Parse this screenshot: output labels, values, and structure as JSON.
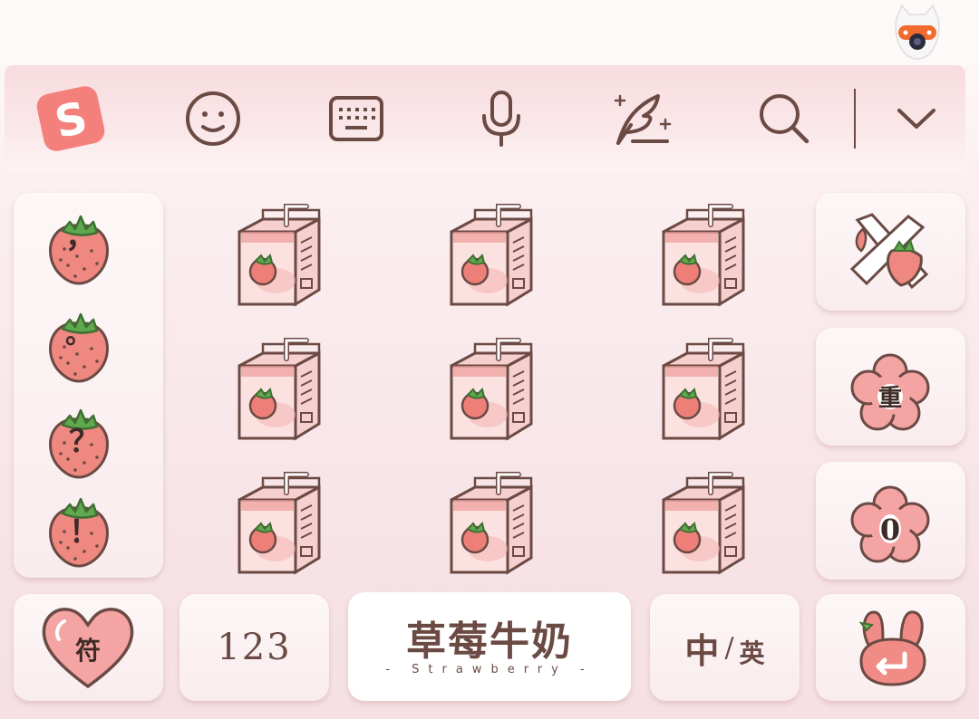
{
  "toolbar": {
    "logo_letter": "S",
    "icons": [
      "emoji-icon",
      "keyboard-icon",
      "microphone-icon",
      "handwriting-quill-icon",
      "search-icon",
      "chevron-down-icon"
    ]
  },
  "punctuation": [
    {
      "char": "，",
      "name": "comma"
    },
    {
      "char": "。",
      "name": "period"
    },
    {
      "char": "？",
      "name": "question"
    },
    {
      "char": "！",
      "name": "exclamation"
    }
  ],
  "candidates": [
    "strawberry-milk-box-sticker",
    "strawberry-milk-box-sticker",
    "strawberry-milk-box-sticker",
    "strawberry-milk-box-sticker",
    "strawberry-milk-box-sticker",
    "strawberry-milk-box-sticker",
    "strawberry-milk-box-sticker",
    "strawberry-milk-box-sticker",
    "strawberry-milk-box-sticker"
  ],
  "right_keys": {
    "delete_icon": "strawberry-x-delete-icon",
    "reenter_label": "重",
    "zero_label": "0"
  },
  "bottom_row": {
    "symbol_label": "符",
    "number_label": "123",
    "space_title": "草莓牛奶",
    "space_subtitle": "- Strawberry -",
    "lang_zh": "中",
    "lang_slash": "/",
    "lang_en": "英",
    "enter_icon": "bunny-enter-icon"
  },
  "colors": {
    "ink": "#6b4a44",
    "strawberry": "#ee8880",
    "brand": "#f4807b",
    "leaf": "#5fa84d",
    "key_bg": "#fbf1f2"
  }
}
